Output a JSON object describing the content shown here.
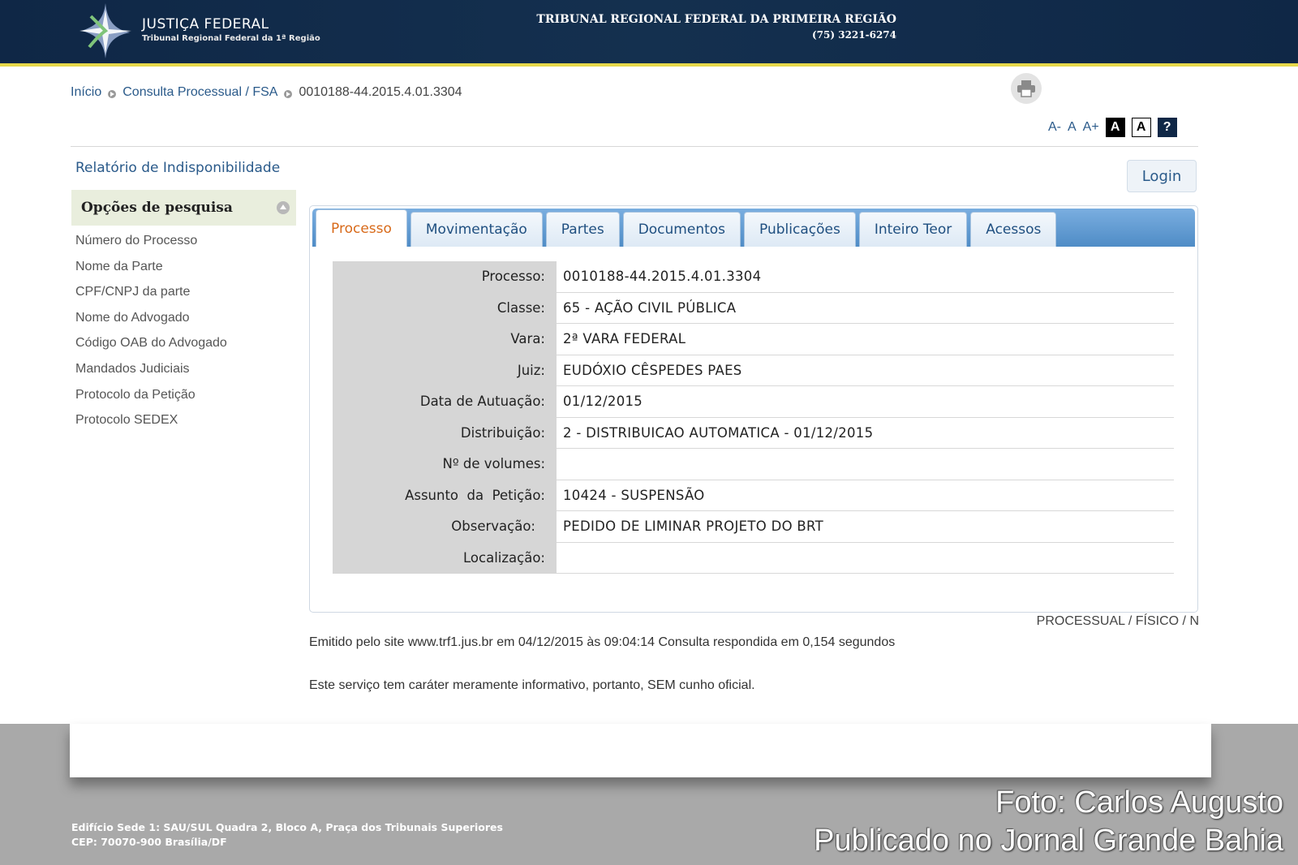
{
  "header": {
    "logo_title": "JUSTIÇA FEDERAL",
    "logo_subtitle": "Tribunal Regional Federal da 1ª Região",
    "court_name": "TRIBUNAL REGIONAL FEDERAL DA PRIMEIRA REGIÃO",
    "court_phone": "(75) 3221-6274"
  },
  "breadcrumb": {
    "home": "Início",
    "section": "Consulta Processual / FSA",
    "current": "0010188-44.2015.4.01.3304"
  },
  "font_controls": {
    "decrease": "A-",
    "normal": "A",
    "increase": "A+",
    "contrast_dark": "A",
    "contrast_light": "A",
    "help": "?"
  },
  "sidebar": {
    "report_link": "Relatório de Indisponibilidade",
    "options_title": "Opções de pesquisa",
    "items": [
      "Número do Processo",
      "Nome da Parte",
      "CPF/CNPJ da parte",
      "Nome do Advogado",
      "Código OAB do Advogado",
      "Mandados Judiciais",
      "Protocolo da Petição",
      "Protocolo SEDEX"
    ]
  },
  "login_label": "Login",
  "tabs": [
    "Processo",
    "Movimentação",
    "Partes",
    "Documentos",
    "Publicações",
    "Inteiro Teor",
    "Acessos"
  ],
  "active_tab": "Processo",
  "details": [
    {
      "label": "Processo:",
      "value": "0010188-44.2015.4.01.3304"
    },
    {
      "label": "Classe:",
      "value": "65 - AÇÃO CIVIL PÚBLICA"
    },
    {
      "label": "Vara:",
      "value": "2ª VARA FEDERAL"
    },
    {
      "label": "Juiz:",
      "value": "EUDÓXIO CÊSPEDES PAES"
    },
    {
      "label": "Data de Autuação:",
      "value": "01/12/2015"
    },
    {
      "label": "Distribuição:",
      "value": "2 - DISTRIBUICAO AUTOMATICA - 01/12/2015"
    },
    {
      "label": "Nº de volumes:",
      "value": ""
    },
    {
      "label": "Assunto  da  Petição:",
      "value": "10424 - SUSPENSÃO"
    },
    {
      "label": "Observação:",
      "value": "PEDIDO DE LIMINAR PROJETO DO BRT"
    },
    {
      "label": "Localização:",
      "value": ""
    }
  ],
  "processual_note": "PROCESSUAL / FÍSICO / N",
  "emit_text": "Emitido pelo site www.trf1.jus.br em 04/12/2015 às 09:04:14 Consulta respondida em 0,154 segundos",
  "info_text": "Este serviço tem caráter meramente informativo, portanto, SEM cunho oficial.",
  "footer": {
    "address_line1": "Edifício Sede 1: SAU/SUL Quadra 2, Bloco A, Praça dos Tribunais Superiores",
    "address_line2": "CEP: 70070-900 Brasília/DF",
    "photo_credit": "Foto: Carlos Augusto",
    "published": "Publicado no Jornal Grande Bahia"
  },
  "colors": {
    "header_bg": "#0f2746",
    "header_accent": "#e6d84a",
    "link": "#2a5a8a",
    "active_tab_text": "#d86a1a",
    "tabbar": "#4f8cc6",
    "footer_bg": "#a9a9a9"
  }
}
